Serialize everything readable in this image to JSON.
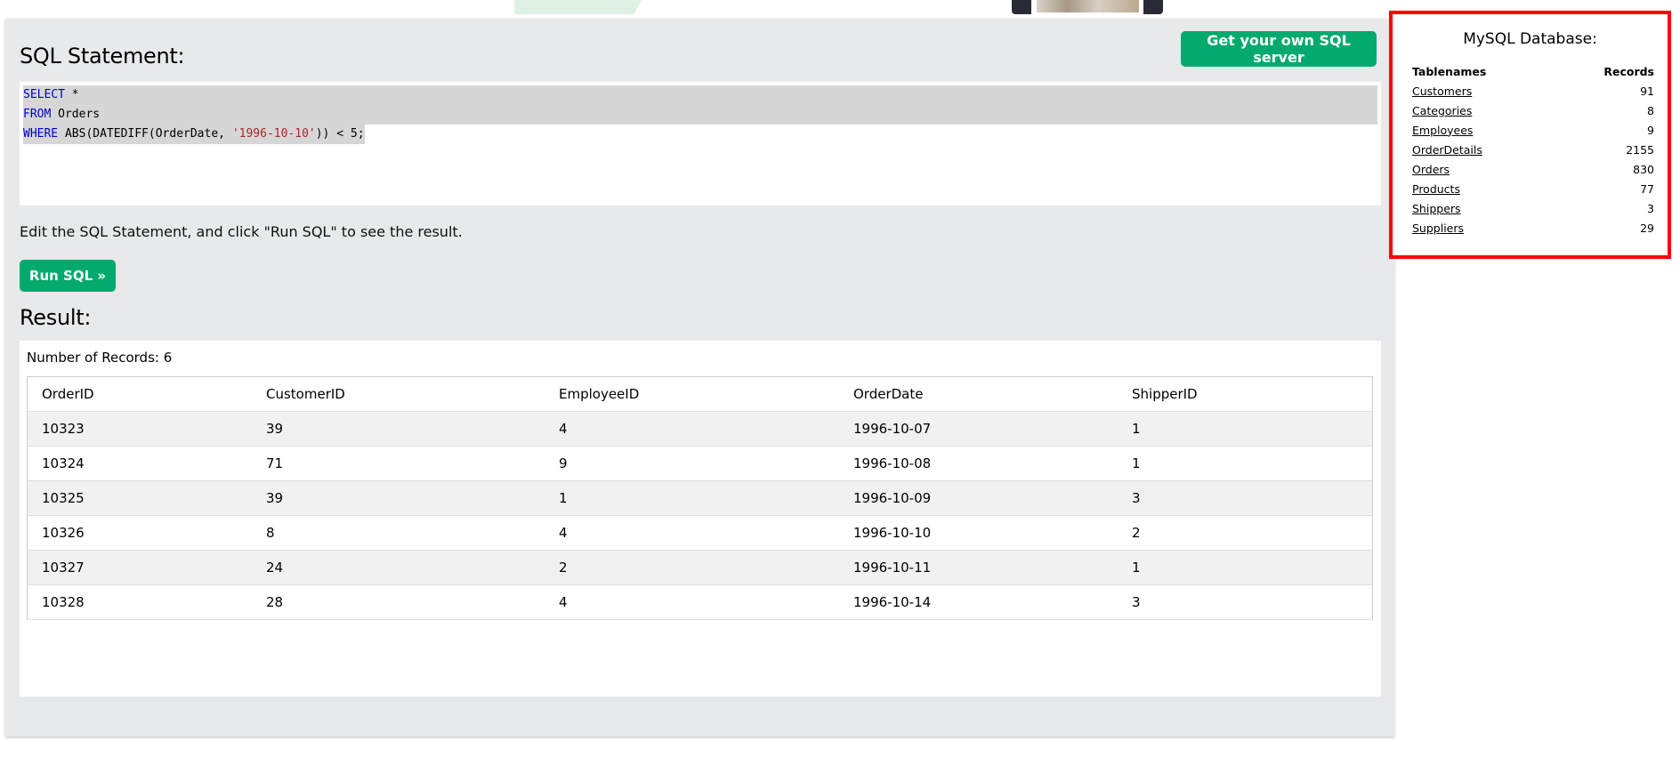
{
  "sql_editor": {
    "heading": "SQL Statement:",
    "get_server_label": "Get your own SQL server",
    "lines": [
      {
        "kw": "SELECT",
        "rest": " *",
        "str": "",
        "tail": ""
      },
      {
        "kw": "FROM",
        "rest": " Orders",
        "str": "",
        "tail": ""
      },
      {
        "kw": "WHERE",
        "rest": " ABS(DATEDIFF(OrderDate, ",
        "str": "'1996-10-10'",
        "tail": ")) < 5;"
      }
    ],
    "hint": "Edit the SQL Statement, and click \"Run SQL\" to see the result.",
    "run_label": "Run SQL »"
  },
  "result": {
    "heading": "Result:",
    "records_count": "Number of Records: 6",
    "columns": [
      "OrderID",
      "CustomerID",
      "EmployeeID",
      "OrderDate",
      "ShipperID"
    ],
    "rows": [
      [
        "10323",
        "39",
        "4",
        "1996-10-07",
        "1"
      ],
      [
        "10324",
        "71",
        "9",
        "1996-10-08",
        "1"
      ],
      [
        "10325",
        "39",
        "1",
        "1996-10-09",
        "3"
      ],
      [
        "10326",
        "8",
        "4",
        "1996-10-10",
        "2"
      ],
      [
        "10327",
        "24",
        "2",
        "1996-10-11",
        "1"
      ],
      [
        "10328",
        "28",
        "4",
        "1996-10-14",
        "3"
      ]
    ]
  },
  "database": {
    "title": "MySQL Database:",
    "col_tablenames": "Tablenames",
    "col_records": "Records",
    "tables": [
      {
        "name": "Customers",
        "records": "91"
      },
      {
        "name": "Categories",
        "records": "8"
      },
      {
        "name": "Employees",
        "records": "9"
      },
      {
        "name": "OrderDetails",
        "records": "2155"
      },
      {
        "name": "Orders",
        "records": "830"
      },
      {
        "name": "Products",
        "records": "77"
      },
      {
        "name": "Shippers",
        "records": "3"
      },
      {
        "name": "Suppliers",
        "records": "29"
      }
    ]
  },
  "colors": {
    "accent_green": "#04aa6d",
    "panel_bg": "#e7e9eb",
    "sql_keyword": "#0000cd",
    "sql_string": "#a52a2a",
    "highlight_border": "#ff0000"
  }
}
